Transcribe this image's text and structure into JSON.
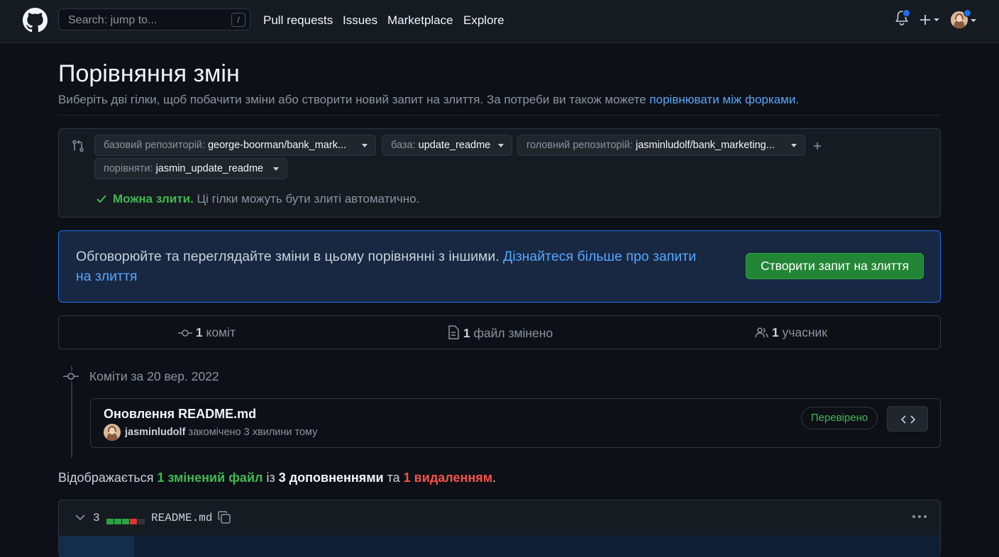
{
  "header": {
    "search_placeholder": "Search: jump to...",
    "search_shortcut": "/",
    "nav": [
      "Pull requests",
      "Issues",
      "Marketplace",
      "Explore"
    ]
  },
  "page": {
    "title": "Порівняння змін",
    "subtitle_prefix": "Виберіть дві гілки, щоб побачити зміни або створити новий запит на злиття. За потреби ви також можете ",
    "subtitle_link": "порівнювати між форками",
    "subtitle_suffix": "."
  },
  "compare": {
    "base_repo_label": "базовий репозиторій:",
    "base_repo_value": "george-boorman/bank_mark...",
    "base_label": "база:",
    "base_value": "update_readme",
    "head_repo_label": "головний репозиторій:",
    "head_repo_value": "jasminludolf/bank_marketing...",
    "compare_label": "порівняти:",
    "compare_value": "jasmin_update_readme",
    "merge_status_bold": "Можна злити.",
    "merge_status_text": " Ці гілки можуть бути злиті автоматично."
  },
  "flash": {
    "text": "Обговорюйте та переглядайте зміни в цьому порівнянні з іншими. ",
    "link": "Дізнайтеся більше про запити на злиття",
    "button": "Створити запит на злиття"
  },
  "stats": {
    "commits_count": "1",
    "commits_label": " коміт",
    "files_count": "1",
    "files_label": " файл змінено",
    "contributors_count": "1",
    "contributors_label": " учасник"
  },
  "timeline": {
    "date_label": "Коміти за 20 вер. 2022",
    "commit_message": "Оновлення README.md",
    "author": "jasminludolf",
    "commit_time": " закомічено 3 хвилини тому",
    "verified": "Перевірено"
  },
  "summary": {
    "prefix": "Відображається ",
    "files": "1 змінений файл",
    "mid1": " із ",
    "additions": "3 доповненнями",
    "mid2": " та ",
    "deletions": "1 видаленням",
    "end": "."
  },
  "file": {
    "changes": "3",
    "name": "README.md"
  },
  "colors": {
    "accent": "#58a6ff",
    "success": "#3fb950",
    "danger": "#f85149",
    "button_green": "#238636"
  }
}
